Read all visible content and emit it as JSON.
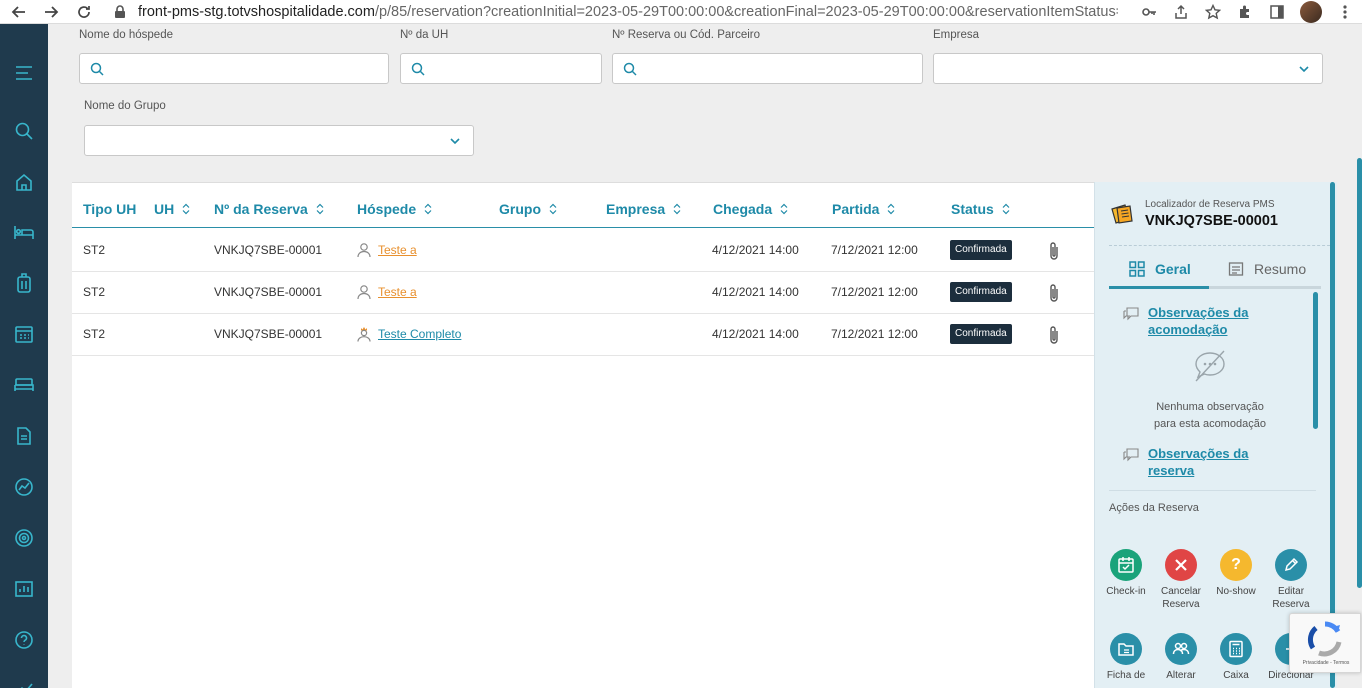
{
  "browser": {
    "url_host": "front-pms-stg.totvshospitalidade.com",
    "url_path": "/p/85/reservation?creationInitial=2023-05-29T00:00:00&creationFinal=2023-05-29T00:00:00&reservationItemStatus=1..."
  },
  "filters": {
    "guest_name_label": "Nome do hóspede",
    "room_number_label": "Nº da UH",
    "reservation_label": "Nº Reserva ou Cód. Parceiro",
    "company_label": "Empresa",
    "group_name_label": "Nome do Grupo"
  },
  "table": {
    "headers": {
      "room_type": "Tipo UH",
      "room": "UH",
      "reservation": "Nº da Reserva",
      "guest": "Hóspede",
      "group": "Grupo",
      "company": "Empresa",
      "arrival": "Chegada",
      "departure": "Partida",
      "status": "Status"
    },
    "rows": [
      {
        "room_type": "ST2",
        "room": "",
        "reservation": "VNKJQ7SBE-00001",
        "guest": "Teste a",
        "guest_color": "#e8902e",
        "group": "",
        "company": "",
        "arrival": "4/12/2021 14:00",
        "departure": "7/12/2021 12:00",
        "status": "Confirmada"
      },
      {
        "room_type": "ST2",
        "room": "",
        "reservation": "VNKJQ7SBE-00001",
        "guest": "Teste a",
        "guest_color": "#e8902e",
        "group": "",
        "company": "",
        "arrival": "4/12/2021 14:00",
        "departure": "7/12/2021 12:00",
        "status": "Confirmada"
      },
      {
        "room_type": "ST2",
        "room": "",
        "reservation": "VNKJQ7SBE-00001",
        "guest": "Teste Completo",
        "guest_color": "#1e8aa8",
        "group": "",
        "company": "",
        "arrival": "4/12/2021 14:00",
        "departure": "7/12/2021 12:00",
        "status": "Confirmada"
      }
    ]
  },
  "right_panel": {
    "locator_label": "Localizador de Reserva PMS",
    "locator_code": "VNKJQ7SBE-00001",
    "tab_general": "Geral",
    "tab_summary": "Resumo",
    "obs_room_line1": "Observações da",
    "obs_room_line2": "acomodação",
    "empty_line1": "Nenhuma observação",
    "empty_line2": "para esta acomodação",
    "obs_res_line1": "Observações da",
    "obs_res_line2": "reserva",
    "actions_label": "Ações da Reserva",
    "actions": [
      {
        "line1": "Check-in",
        "line2": "",
        "color": "#1aa37a",
        "icon": "calendar-check-icon"
      },
      {
        "line1": "Cancelar",
        "line2": "Reserva",
        "color": "#e04545",
        "icon": "close-icon"
      },
      {
        "line1": "No-show",
        "line2": "",
        "color": "#f5b82e",
        "icon": "question-icon"
      },
      {
        "line1": "Editar",
        "line2": "Reserva",
        "color": "#2a8fa8",
        "icon": "pencil-icon"
      },
      {
        "line1": "Ficha de",
        "line2": "",
        "color": "#2a8fa8",
        "icon": "folder-icon"
      },
      {
        "line1": "Alterar",
        "line2": "",
        "color": "#2a8fa8",
        "icon": "users-icon"
      },
      {
        "line1": "Caixa",
        "line2": "",
        "color": "#2a8fa8",
        "icon": "calculator-icon"
      },
      {
        "line1": "Direcionar",
        "line2": "",
        "color": "#2a8fa8",
        "icon": "direct-icon"
      }
    ]
  },
  "recaptcha": {
    "text": "Privacidade - Termos"
  }
}
